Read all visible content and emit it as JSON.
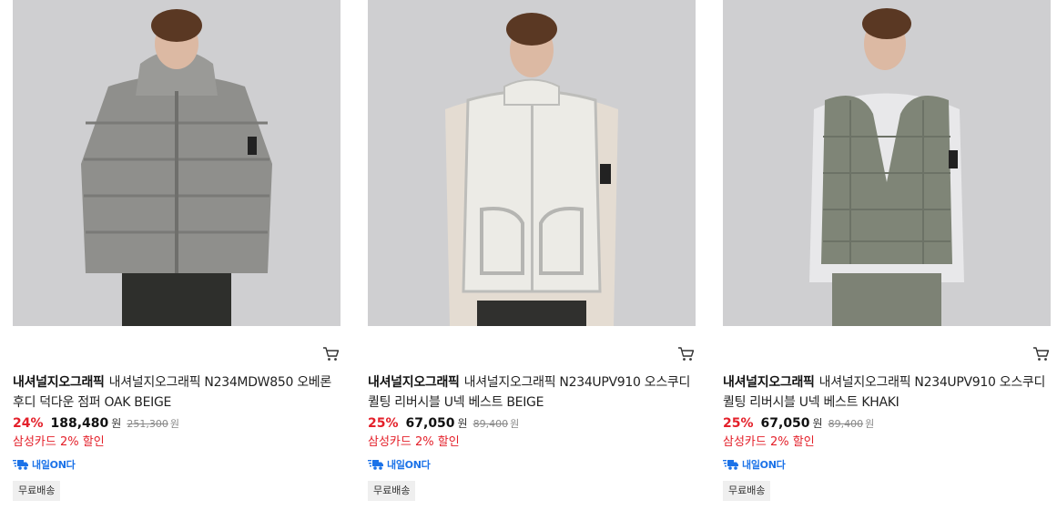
{
  "products": [
    {
      "brand": "내셔널지오그래픽",
      "name": "내셔널지오그래픽 N234MDW850 오베론 후디 덕다운 점퍼 OAK BEIGE",
      "discount": "24%",
      "sale_price": "188,480",
      "currency": "원",
      "original_price": "251,300",
      "card_discount": "삼성카드 2% 할인",
      "delivery_badge": "내일ON다",
      "shipping": "무료배송",
      "image": {
        "garment": "hooded-puffer-jacket",
        "color": "#8f8f8c"
      }
    },
    {
      "brand": "내셔널지오그래픽",
      "name": "내셔널지오그래픽 N234UPV910 오스쿠디 퀼팅 리버시블 U넥 베스트 BEIGE",
      "discount": "25%",
      "sale_price": "67,050",
      "currency": "원",
      "original_price": "89,400",
      "card_discount": "삼성카드 2% 할인",
      "delivery_badge": "내일ON다",
      "shipping": "무료배송",
      "image": {
        "garment": "fleece-vest",
        "color": "#ecebe6"
      }
    },
    {
      "brand": "내셔널지오그래픽",
      "name": "내셔널지오그래픽 N234UPV910 오스쿠디 퀼팅 리버시블 U넥 베스트 KHAKI",
      "discount": "25%",
      "sale_price": "67,050",
      "currency": "원",
      "original_price": "89,400",
      "card_discount": "삼성카드 2% 할인",
      "delivery_badge": "내일ON다",
      "shipping": "무료배송",
      "image": {
        "garment": "quilted-vest",
        "color": "#7f8577"
      }
    }
  ],
  "icons": {
    "cart": "cart-icon",
    "delivery": "delivery-truck-icon"
  },
  "colors": {
    "discount_red": "#e4202a",
    "delivery_blue": "#1b72e8",
    "image_bg": "#cfcfd1"
  }
}
